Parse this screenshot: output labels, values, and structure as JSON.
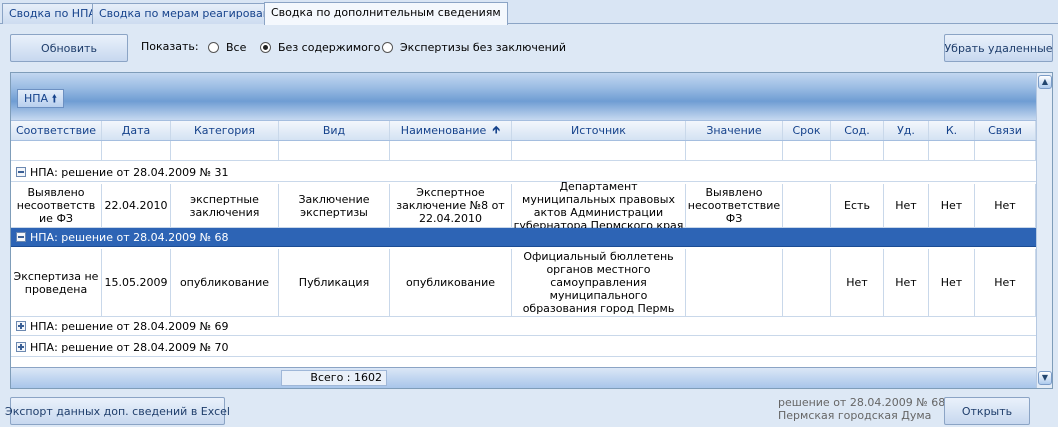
{
  "tabs": [
    "Сводка по НПА",
    "Сводка по мерам реагирования",
    "Сводка по дополнительным сведениям"
  ],
  "toolbar": {
    "refresh": "Обновить",
    "show_label": "Показать:",
    "radios": [
      "Все",
      "Без содержимого",
      "Экспертизы без заключений"
    ],
    "selected": "Без содержимого",
    "remove_deleted": "Убрать удаленные"
  },
  "grid": {
    "group_chip": "НПА",
    "columns": [
      "Соответствие",
      "Дата",
      "Категория",
      "Вид",
      "Наименование",
      "Источник",
      "Значение",
      "Срок",
      "Сод.",
      "Уд.",
      "К.",
      "Связи"
    ],
    "sorted_column": "Наименование",
    "groups": [
      {
        "label": "НПА: решение от 28.04.2009 № 31",
        "expanded": true,
        "selected": false,
        "rows": [
          [
            "Выявлено несоответств ие ФЗ",
            "22.04.2010",
            "экспертные заключения",
            "Заключение экспертизы",
            "Экспертное заключение №8 от 22.04.2010",
            "Департамент муниципальных правовых актов Администрации губернатора Пермского края",
            "Выявлено несоответствие ФЗ",
            "",
            "Есть",
            "Нет",
            "Нет",
            "Нет"
          ]
        ]
      },
      {
        "label": "НПА: решение от 28.04.2009 № 68",
        "expanded": true,
        "selected": true,
        "rows": [
          [
            "Экспертиза не проведена",
            "15.05.2009",
            "опубликование",
            "Публикация",
            "опубликование",
            "Официальный бюллетень органов местного самоуправления муниципального образования город Пермь",
            "",
            "",
            "Нет",
            "Нет",
            "Нет",
            "Нет"
          ]
        ]
      },
      {
        "label": "НПА: решение от 28.04.2009 № 69",
        "expanded": false,
        "selected": false,
        "rows": []
      },
      {
        "label": "НПА: решение от 28.04.2009 № 70",
        "expanded": false,
        "selected": false,
        "rows": []
      }
    ],
    "total": "Всего : 1602"
  },
  "footer": {
    "export": "Экспорт данных доп. сведений в Excel",
    "status_line1": "решение от 28.04.2009 № 68",
    "status_line2": "Пермская городская Дума",
    "open": "Открыть"
  }
}
